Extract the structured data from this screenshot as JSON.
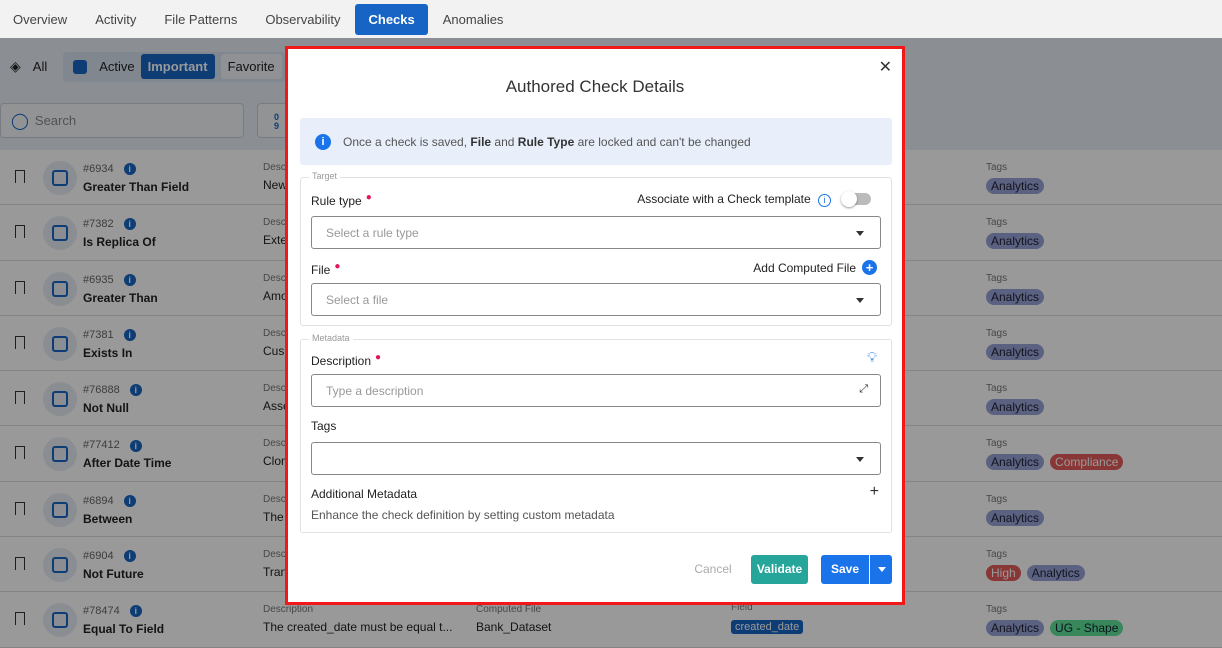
{
  "tabs": [
    "Overview",
    "Activity",
    "File Patterns",
    "Observability",
    "Checks",
    "Anomalies"
  ],
  "active_tab": "Checks",
  "filters": {
    "all": "All",
    "active": "Active",
    "important": "Important",
    "favorite": "Favorite"
  },
  "search": {
    "placeholder": "Search"
  },
  "sort_icon_text": "0\n9",
  "row_labels": {
    "description": "Description",
    "computed_file": "Computed File",
    "field": "Field",
    "tags": "Tags"
  },
  "rows": [
    {
      "id": "#6934",
      "name": "Greater Than Field",
      "desc": "New",
      "tags": [
        {
          "t": "Analytics",
          "c": "blue"
        }
      ]
    },
    {
      "id": "#7382",
      "name": "Is Replica Of",
      "desc": "Exte",
      "tags": [
        {
          "t": "Analytics",
          "c": "blue"
        }
      ]
    },
    {
      "id": "#6935",
      "name": "Greater Than",
      "desc": "Amo",
      "tags": [
        {
          "t": "Analytics",
          "c": "blue"
        }
      ]
    },
    {
      "id": "#7381",
      "name": "Exists In",
      "desc": "Cus",
      "tags": [
        {
          "t": "Analytics",
          "c": "blue"
        }
      ]
    },
    {
      "id": "#76888",
      "name": "Not Null",
      "desc": "Asse",
      "tags": [
        {
          "t": "Analytics",
          "c": "blue"
        }
      ]
    },
    {
      "id": "#77412",
      "name": "After Date Time",
      "desc": "Clon",
      "tags": [
        {
          "t": "Analytics",
          "c": "blue"
        },
        {
          "t": "Compliance",
          "c": "red"
        }
      ]
    },
    {
      "id": "#6894",
      "name": "Between",
      "desc": "The",
      "tags": [
        {
          "t": "Analytics",
          "c": "blue"
        }
      ]
    },
    {
      "id": "#6904",
      "name": "Not Future",
      "desc": "Tran",
      "tags": [
        {
          "t": "High",
          "c": "red"
        },
        {
          "t": "Analytics",
          "c": "blue"
        }
      ]
    },
    {
      "id": "#78474",
      "name": "Equal To Field",
      "desc": "The created_date must be equal t...",
      "computed_file": "Bank_Dataset",
      "field": "created_date",
      "tags": [
        {
          "t": "Analytics",
          "c": "blue"
        },
        {
          "t": "UG - Shape",
          "c": "green"
        }
      ]
    }
  ],
  "modal": {
    "title": "Authored Check Details",
    "notice": {
      "pre": "Once a check is saved, ",
      "b1": "File",
      "mid": " and ",
      "b2": "Rule Type",
      "post": " are locked and can't be changed"
    },
    "target_legend": "Target",
    "rule_type_label": "Rule type",
    "associate_label": "Associate with a Check template",
    "associate_on": false,
    "rule_type_placeholder": "Select a rule type",
    "file_label": "File",
    "add_computed_file": "Add Computed File",
    "file_placeholder": "Select a file",
    "metadata_legend": "Metadata",
    "description_label": "Description",
    "description_placeholder": "Type a description",
    "tags_label": "Tags",
    "additional_metadata": "Additional Metadata",
    "additional_metadata_hint": "Enhance the check definition by setting custom metadata",
    "cancel": "Cancel",
    "validate": "Validate",
    "save": "Save"
  },
  "colors": {
    "accent": "#1864c4",
    "validate": "#26a69a",
    "save": "#1a73e8",
    "modal_border": "#f01818"
  }
}
